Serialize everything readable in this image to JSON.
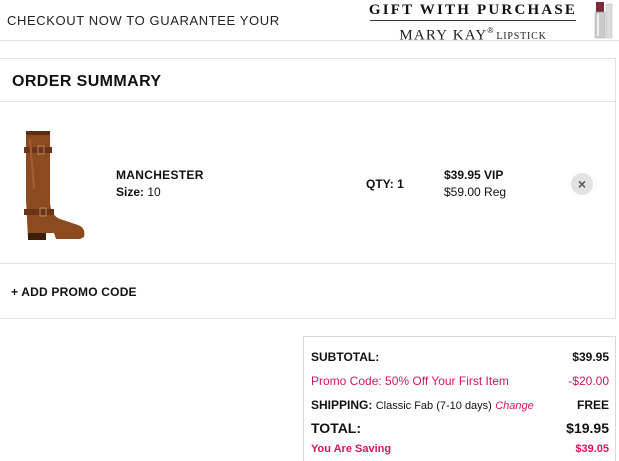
{
  "banner": {
    "left_text": "CHECKOUT NOW TO GUARANTEE YOUR",
    "gift_text": "GIFT WITH PURCHASE",
    "brand": "MARY KAY",
    "brand_mark": "®",
    "brand_sub": "LIPSTICK"
  },
  "summary": {
    "title": "ORDER SUMMARY",
    "item": {
      "name": "MANCHESTER",
      "size_label": "Size:",
      "size_value": "10",
      "qty_label": "QTY:",
      "qty_value": "1",
      "price_vip": "$39.95 VIP",
      "price_reg": "$59.00 Reg",
      "remove_glyph": "×"
    },
    "promo_link": "+ ADD PROMO CODE"
  },
  "totals": {
    "subtotal_label": "SUBTOTAL:",
    "subtotal_value": "$39.95",
    "promo_label": "Promo Code: 50% Off Your First Item",
    "promo_value": "-$20.00",
    "shipping_label": "SHIPPING:",
    "shipping_method": "Classic Fab (7-10 days)",
    "shipping_change": "Change",
    "shipping_value": "FREE",
    "total_label": "TOTAL:",
    "total_value": "$19.95",
    "saving_label": "You Are Saving",
    "saving_value": "$39.05"
  },
  "colors": {
    "accent_pink": "#d6145f",
    "boot_brown": "#8b4a22"
  }
}
